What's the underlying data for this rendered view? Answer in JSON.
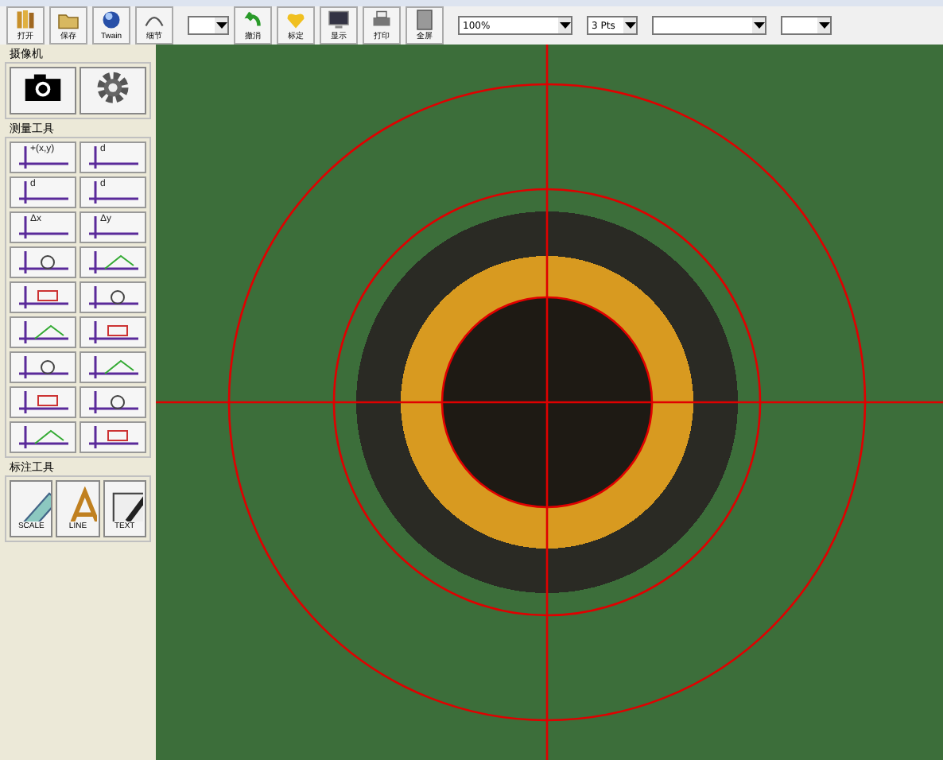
{
  "toolbar": {
    "items": [
      {
        "kind": "button",
        "label": "打开"
      },
      {
        "kind": "button",
        "label": "保存"
      },
      {
        "kind": "button",
        "label": "Twain"
      },
      {
        "kind": "button",
        "label": "细节"
      },
      {
        "kind": "combo"
      },
      {
        "kind": "button",
        "label": "撤消"
      },
      {
        "kind": "button",
        "label": "标定"
      },
      {
        "kind": "button",
        "label": "显示"
      },
      {
        "kind": "button",
        "label": "打印"
      },
      {
        "kind": "button",
        "label": "全屏"
      },
      {
        "kind": "combo",
        "value": "100%"
      },
      {
        "kind": "combo",
        "value": "3 Pts"
      },
      {
        "kind": "combo"
      },
      {
        "kind": "combo"
      }
    ]
  },
  "camera_group": {
    "title": "摄像机"
  },
  "measure_group": {
    "title": "测量工具",
    "tools": [
      {
        "kind": "labeled",
        "label": "+(x,y)"
      },
      {
        "kind": "labeled",
        "label": "d"
      },
      {
        "kind": "labeled",
        "label": "d"
      },
      {
        "kind": "labeled",
        "label": "d"
      },
      {
        "kind": "labeled",
        "label": "Δx"
      },
      {
        "kind": "labeled",
        "label": "Δy"
      },
      {
        "kind": "circle"
      },
      {
        "kind": "angle"
      },
      {
        "kind": "rect"
      },
      {
        "kind": "circle"
      },
      {
        "kind": "angle"
      },
      {
        "kind": "rect"
      },
      {
        "kind": "circle"
      },
      {
        "kind": "angle"
      },
      {
        "kind": "rect"
      },
      {
        "kind": "circle"
      },
      {
        "kind": "angle"
      },
      {
        "kind": "rect"
      }
    ]
  },
  "annotate_group": {
    "title": "标注工具",
    "buttons": [
      {
        "label": "SCALE"
      },
      {
        "label": "LINE"
      },
      {
        "label": "TEXT"
      }
    ]
  }
}
